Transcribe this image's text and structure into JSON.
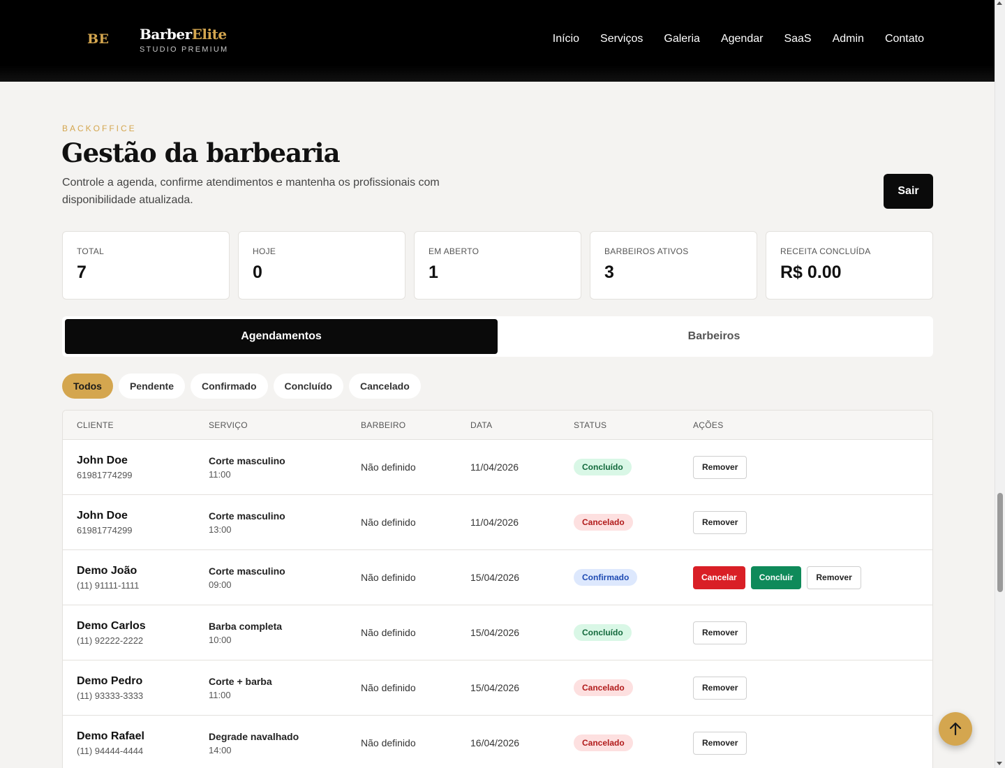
{
  "brand": {
    "mark": "BE",
    "name_part1": "Barber",
    "name_part2": "Elite",
    "subtitle": "STUDIO PREMIUM"
  },
  "nav": [
    "Início",
    "Serviços",
    "Galeria",
    "Agendar",
    "SaaS",
    "Admin",
    "Contato"
  ],
  "hero": {
    "eyebrow": "BACKOFFICE",
    "title": "Gestão da barbearia",
    "description": "Controle a agenda, confirme atendimentos e mantenha os profissionais com disponibilidade atualizada.",
    "logout_label": "Sair"
  },
  "stats": [
    {
      "label": "Total",
      "value": "7"
    },
    {
      "label": "Hoje",
      "value": "0"
    },
    {
      "label": "Em aberto",
      "value": "1"
    },
    {
      "label": "Barbeiros ativos",
      "value": "3"
    },
    {
      "label": "Receita concluída",
      "value": "R$ 0.00"
    }
  ],
  "tabs": [
    {
      "label": "Agendamentos",
      "active": true
    },
    {
      "label": "Barbeiros",
      "active": false
    }
  ],
  "filters": [
    {
      "label": "Todos",
      "active": true
    },
    {
      "label": "Pendente",
      "active": false
    },
    {
      "label": "Confirmado",
      "active": false
    },
    {
      "label": "Concluído",
      "active": false
    },
    {
      "label": "Cancelado",
      "active": false
    }
  ],
  "table": {
    "headers": [
      "CLIENTE",
      "SERVIÇO",
      "BARBEIRO",
      "DATA",
      "STATUS",
      "AÇÕES"
    ],
    "rows": [
      {
        "name": "John Doe",
        "phone": "61981774299",
        "service": "Corte masculino",
        "time": "11:00",
        "barber": "Não definido",
        "date": "11/04/2026",
        "status": "Concluído",
        "status_kind": "done",
        "actions": [
          "Remover"
        ]
      },
      {
        "name": "John Doe",
        "phone": "61981774299",
        "service": "Corte masculino",
        "time": "13:00",
        "barber": "Não definido",
        "date": "11/04/2026",
        "status": "Cancelado",
        "status_kind": "cancel",
        "actions": [
          "Remover"
        ]
      },
      {
        "name": "Demo João",
        "phone": "(11) 91111-1111",
        "service": "Corte masculino",
        "time": "09:00",
        "barber": "Não definido",
        "date": "15/04/2026",
        "status": "Confirmado",
        "status_kind": "confirm",
        "actions": [
          "Cancelar",
          "Concluir",
          "Remover"
        ]
      },
      {
        "name": "Demo Carlos",
        "phone": "(11) 92222-2222",
        "service": "Barba completa",
        "time": "10:00",
        "barber": "Não definido",
        "date": "15/04/2026",
        "status": "Concluído",
        "status_kind": "done",
        "actions": [
          "Remover"
        ]
      },
      {
        "name": "Demo Pedro",
        "phone": "(11) 93333-3333",
        "service": "Corte + barba",
        "time": "11:00",
        "barber": "Não definido",
        "date": "15/04/2026",
        "status": "Cancelado",
        "status_kind": "cancel",
        "actions": [
          "Remover"
        ]
      },
      {
        "name": "Demo Rafael",
        "phone": "(11) 94444-4444",
        "service": "Degrade navalhado",
        "time": "14:00",
        "barber": "Não definido",
        "date": "16/04/2026",
        "status": "Cancelado",
        "status_kind": "cancel",
        "actions": [
          "Remover"
        ]
      }
    ]
  },
  "colors": {
    "accent": "#d4a64f",
    "dark": "#0a0a0a",
    "danger": "#d91f26",
    "success": "#0f8a5a"
  },
  "icons": {
    "fab": "arrow-up-icon"
  }
}
